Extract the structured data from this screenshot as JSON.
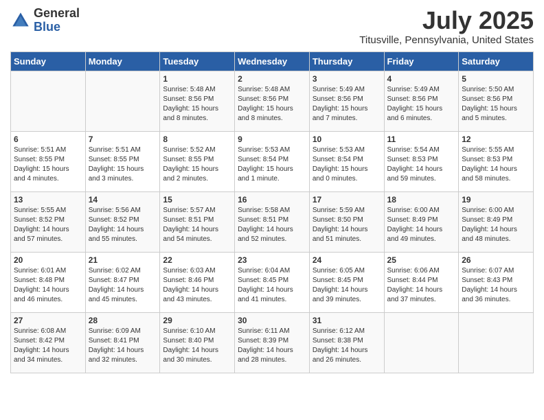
{
  "logo": {
    "general": "General",
    "blue": "Blue"
  },
  "title": "July 2025",
  "location": "Titusville, Pennsylvania, United States",
  "days_of_week": [
    "Sunday",
    "Monday",
    "Tuesday",
    "Wednesday",
    "Thursday",
    "Friday",
    "Saturday"
  ],
  "weeks": [
    [
      {
        "day": "",
        "info": ""
      },
      {
        "day": "",
        "info": ""
      },
      {
        "day": "1",
        "info": "Sunrise: 5:48 AM\nSunset: 8:56 PM\nDaylight: 15 hours\nand 8 minutes."
      },
      {
        "day": "2",
        "info": "Sunrise: 5:48 AM\nSunset: 8:56 PM\nDaylight: 15 hours\nand 8 minutes."
      },
      {
        "day": "3",
        "info": "Sunrise: 5:49 AM\nSunset: 8:56 PM\nDaylight: 15 hours\nand 7 minutes."
      },
      {
        "day": "4",
        "info": "Sunrise: 5:49 AM\nSunset: 8:56 PM\nDaylight: 15 hours\nand 6 minutes."
      },
      {
        "day": "5",
        "info": "Sunrise: 5:50 AM\nSunset: 8:56 PM\nDaylight: 15 hours\nand 5 minutes."
      }
    ],
    [
      {
        "day": "6",
        "info": "Sunrise: 5:51 AM\nSunset: 8:55 PM\nDaylight: 15 hours\nand 4 minutes."
      },
      {
        "day": "7",
        "info": "Sunrise: 5:51 AM\nSunset: 8:55 PM\nDaylight: 15 hours\nand 3 minutes."
      },
      {
        "day": "8",
        "info": "Sunrise: 5:52 AM\nSunset: 8:55 PM\nDaylight: 15 hours\nand 2 minutes."
      },
      {
        "day": "9",
        "info": "Sunrise: 5:53 AM\nSunset: 8:54 PM\nDaylight: 15 hours\nand 1 minute."
      },
      {
        "day": "10",
        "info": "Sunrise: 5:53 AM\nSunset: 8:54 PM\nDaylight: 15 hours\nand 0 minutes."
      },
      {
        "day": "11",
        "info": "Sunrise: 5:54 AM\nSunset: 8:53 PM\nDaylight: 14 hours\nand 59 minutes."
      },
      {
        "day": "12",
        "info": "Sunrise: 5:55 AM\nSunset: 8:53 PM\nDaylight: 14 hours\nand 58 minutes."
      }
    ],
    [
      {
        "day": "13",
        "info": "Sunrise: 5:55 AM\nSunset: 8:52 PM\nDaylight: 14 hours\nand 57 minutes."
      },
      {
        "day": "14",
        "info": "Sunrise: 5:56 AM\nSunset: 8:52 PM\nDaylight: 14 hours\nand 55 minutes."
      },
      {
        "day": "15",
        "info": "Sunrise: 5:57 AM\nSunset: 8:51 PM\nDaylight: 14 hours\nand 54 minutes."
      },
      {
        "day": "16",
        "info": "Sunrise: 5:58 AM\nSunset: 8:51 PM\nDaylight: 14 hours\nand 52 minutes."
      },
      {
        "day": "17",
        "info": "Sunrise: 5:59 AM\nSunset: 8:50 PM\nDaylight: 14 hours\nand 51 minutes."
      },
      {
        "day": "18",
        "info": "Sunrise: 6:00 AM\nSunset: 8:49 PM\nDaylight: 14 hours\nand 49 minutes."
      },
      {
        "day": "19",
        "info": "Sunrise: 6:00 AM\nSunset: 8:49 PM\nDaylight: 14 hours\nand 48 minutes."
      }
    ],
    [
      {
        "day": "20",
        "info": "Sunrise: 6:01 AM\nSunset: 8:48 PM\nDaylight: 14 hours\nand 46 minutes."
      },
      {
        "day": "21",
        "info": "Sunrise: 6:02 AM\nSunset: 8:47 PM\nDaylight: 14 hours\nand 45 minutes."
      },
      {
        "day": "22",
        "info": "Sunrise: 6:03 AM\nSunset: 8:46 PM\nDaylight: 14 hours\nand 43 minutes."
      },
      {
        "day": "23",
        "info": "Sunrise: 6:04 AM\nSunset: 8:45 PM\nDaylight: 14 hours\nand 41 minutes."
      },
      {
        "day": "24",
        "info": "Sunrise: 6:05 AM\nSunset: 8:45 PM\nDaylight: 14 hours\nand 39 minutes."
      },
      {
        "day": "25",
        "info": "Sunrise: 6:06 AM\nSunset: 8:44 PM\nDaylight: 14 hours\nand 37 minutes."
      },
      {
        "day": "26",
        "info": "Sunrise: 6:07 AM\nSunset: 8:43 PM\nDaylight: 14 hours\nand 36 minutes."
      }
    ],
    [
      {
        "day": "27",
        "info": "Sunrise: 6:08 AM\nSunset: 8:42 PM\nDaylight: 14 hours\nand 34 minutes."
      },
      {
        "day": "28",
        "info": "Sunrise: 6:09 AM\nSunset: 8:41 PM\nDaylight: 14 hours\nand 32 minutes."
      },
      {
        "day": "29",
        "info": "Sunrise: 6:10 AM\nSunset: 8:40 PM\nDaylight: 14 hours\nand 30 minutes."
      },
      {
        "day": "30",
        "info": "Sunrise: 6:11 AM\nSunset: 8:39 PM\nDaylight: 14 hours\nand 28 minutes."
      },
      {
        "day": "31",
        "info": "Sunrise: 6:12 AM\nSunset: 8:38 PM\nDaylight: 14 hours\nand 26 minutes."
      },
      {
        "day": "",
        "info": ""
      },
      {
        "day": "",
        "info": ""
      }
    ]
  ]
}
